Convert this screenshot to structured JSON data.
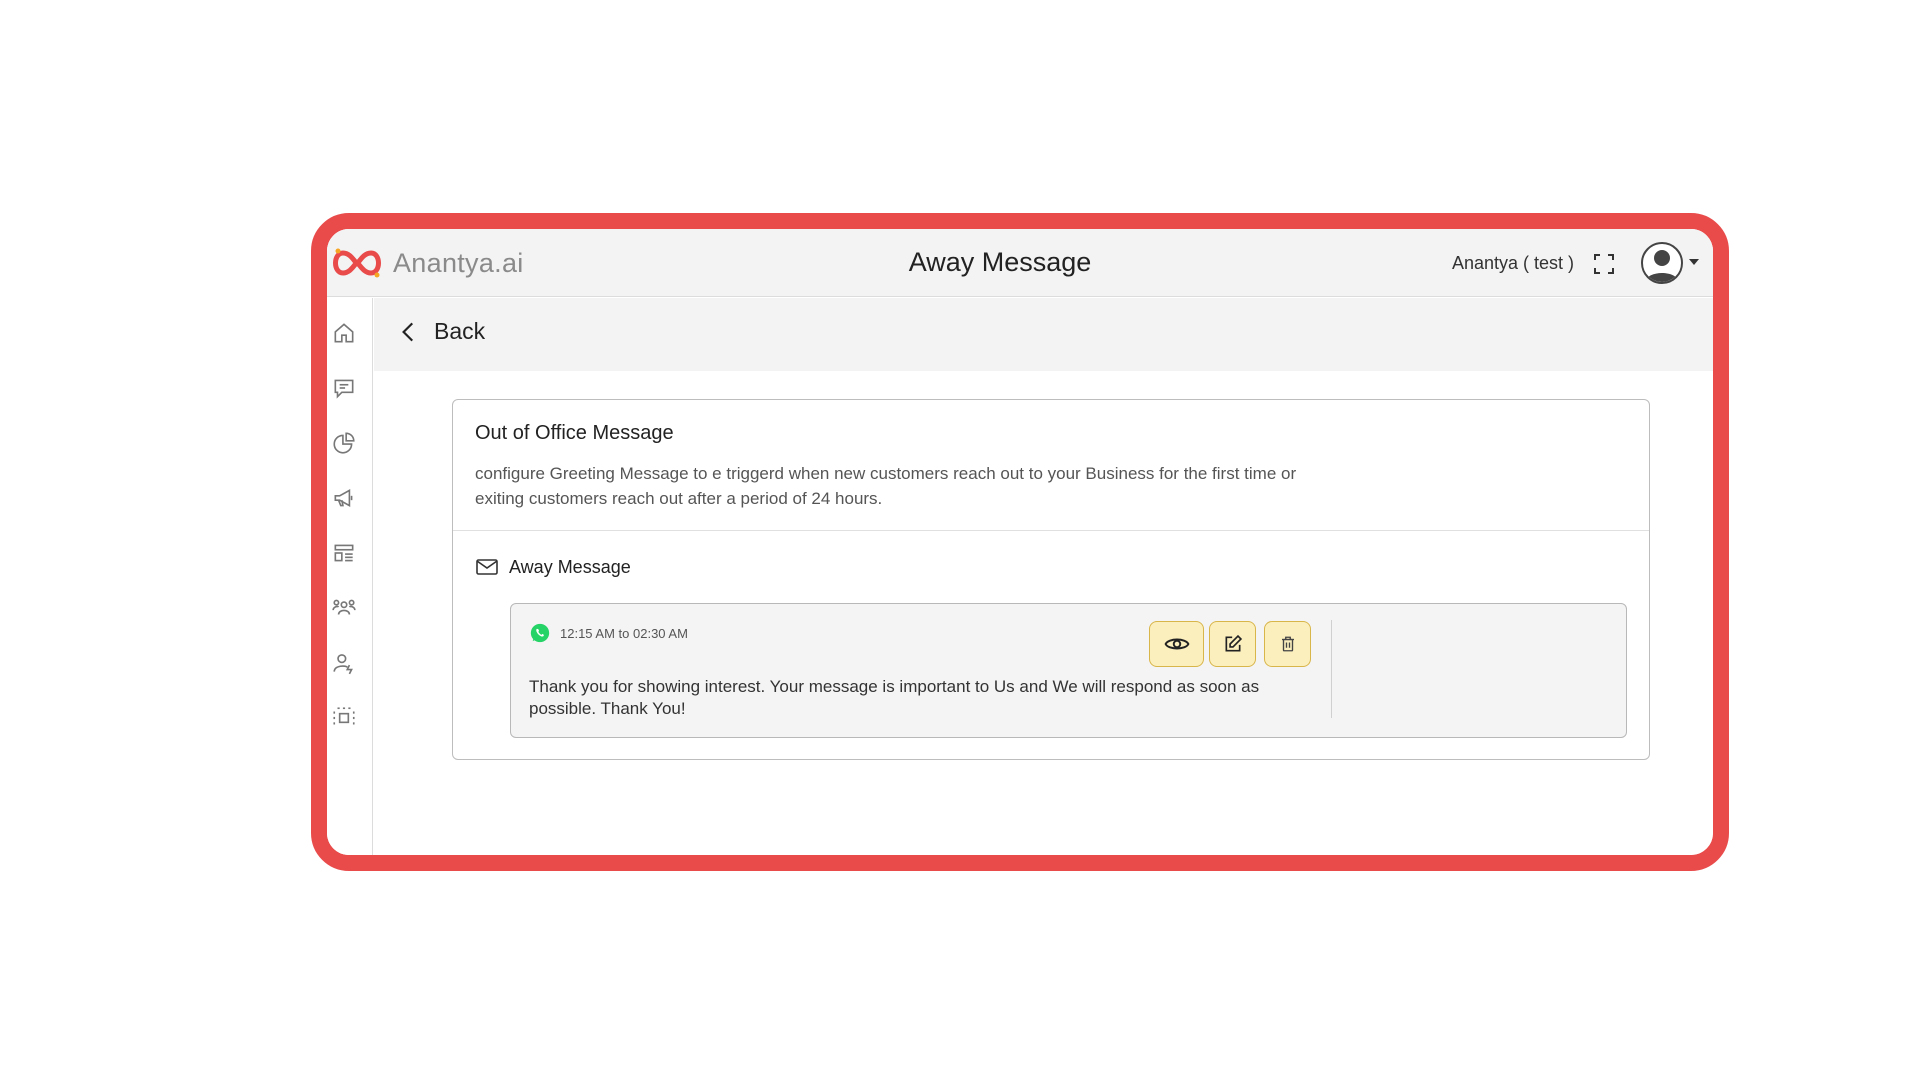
{
  "header": {
    "logo_text": "Anantya.ai",
    "title": "Away Message",
    "user_name": "Anantya ( test )",
    "logo_colors": [
      "#e94b4b",
      "#f5a623"
    ]
  },
  "sidebar": {
    "items": [
      {
        "icon": "home-icon"
      },
      {
        "icon": "chat-icon"
      },
      {
        "icon": "pie-chart-icon"
      },
      {
        "icon": "megaphone-icon"
      },
      {
        "icon": "template-icon"
      },
      {
        "icon": "team-icon"
      },
      {
        "icon": "user-settings-icon"
      },
      {
        "icon": "integration-icon"
      }
    ]
  },
  "backbar": {
    "back_label": "Back"
  },
  "card": {
    "title": "Out of Office Message",
    "description": "configure Greeting Message to e triggerd when new customers reach out to your Business for the first time or exiting customers reach out after a period of 24 hours.",
    "section_label": "Away Message",
    "message": {
      "time_range": "12:15 AM to 02:30 AM",
      "text": "Thank you for showing interest. Your message is important to Us and We will respond as soon as possible. Thank You!",
      "channel_icon": "whatsapp-icon"
    },
    "actions": [
      "view-icon",
      "edit-icon",
      "delete-icon"
    ]
  },
  "colors": {
    "frame": "#e94b4b",
    "action_bg": "#fbefbd",
    "action_border": "#d9b64a",
    "whatsapp": "#25d366"
  }
}
